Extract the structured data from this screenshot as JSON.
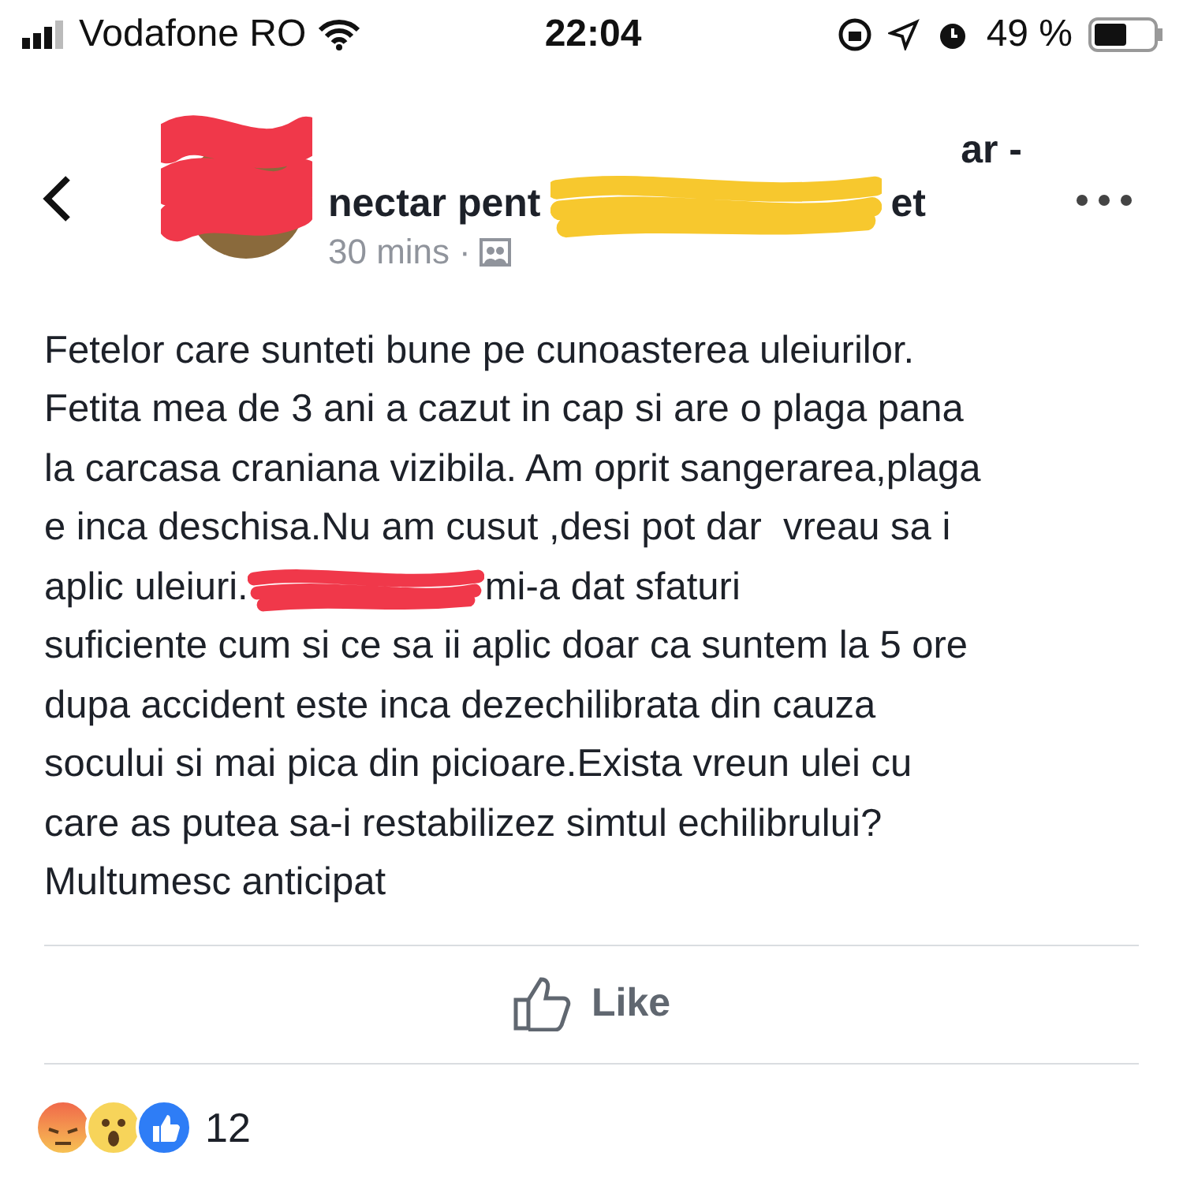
{
  "status_bar": {
    "carrier": "Vodafone RO",
    "time": "22:04",
    "battery": "49 %"
  },
  "post_header": {
    "title_line_1": "ar -",
    "title_line_2_start": "nectar pent",
    "title_line_2_end": "et",
    "time": "30 mins",
    "separator": "·"
  },
  "post": {
    "lines": [
      {
        "kind": "text",
        "text": "Fetelor care sunteti bune pe cunoasterea uleiurilor."
      },
      {
        "kind": "text",
        "text": "Fetita mea de 3 ani a cazut in cap si are o plaga pana"
      },
      {
        "kind": "text",
        "text": "la carcasa craniana vizibila. Am oprit sangerarea,plaga"
      },
      {
        "kind": "text",
        "text": "e inca deschisa.Nu am cusut ,desi pot dar  vreau sa i"
      },
      {
        "kind": "redacted",
        "before": "aplic uleiuri.",
        "after": "mi-a dat sfaturi"
      },
      {
        "kind": "text",
        "text": "suficiente cum si ce sa ii aplic doar ca suntem la 5 ore"
      },
      {
        "kind": "text",
        "text": "dupa accident este inca dezechilibrata din cauza"
      },
      {
        "kind": "text",
        "text": "socului si mai pica din picioare.Exista vreun ulei cu"
      },
      {
        "kind": "text",
        "text": "care as putea sa-i restabilizez simtul echilibrului?"
      },
      {
        "kind": "text",
        "text": "Multumesc anticipat"
      }
    ]
  },
  "actions": [
    {
      "label": "Like",
      "kind": "like"
    }
  ],
  "reactions": {
    "count": "12",
    "types": [
      {
        "kind": "angry"
      },
      {
        "kind": "wow"
      },
      {
        "kind": "like"
      }
    ]
  }
}
